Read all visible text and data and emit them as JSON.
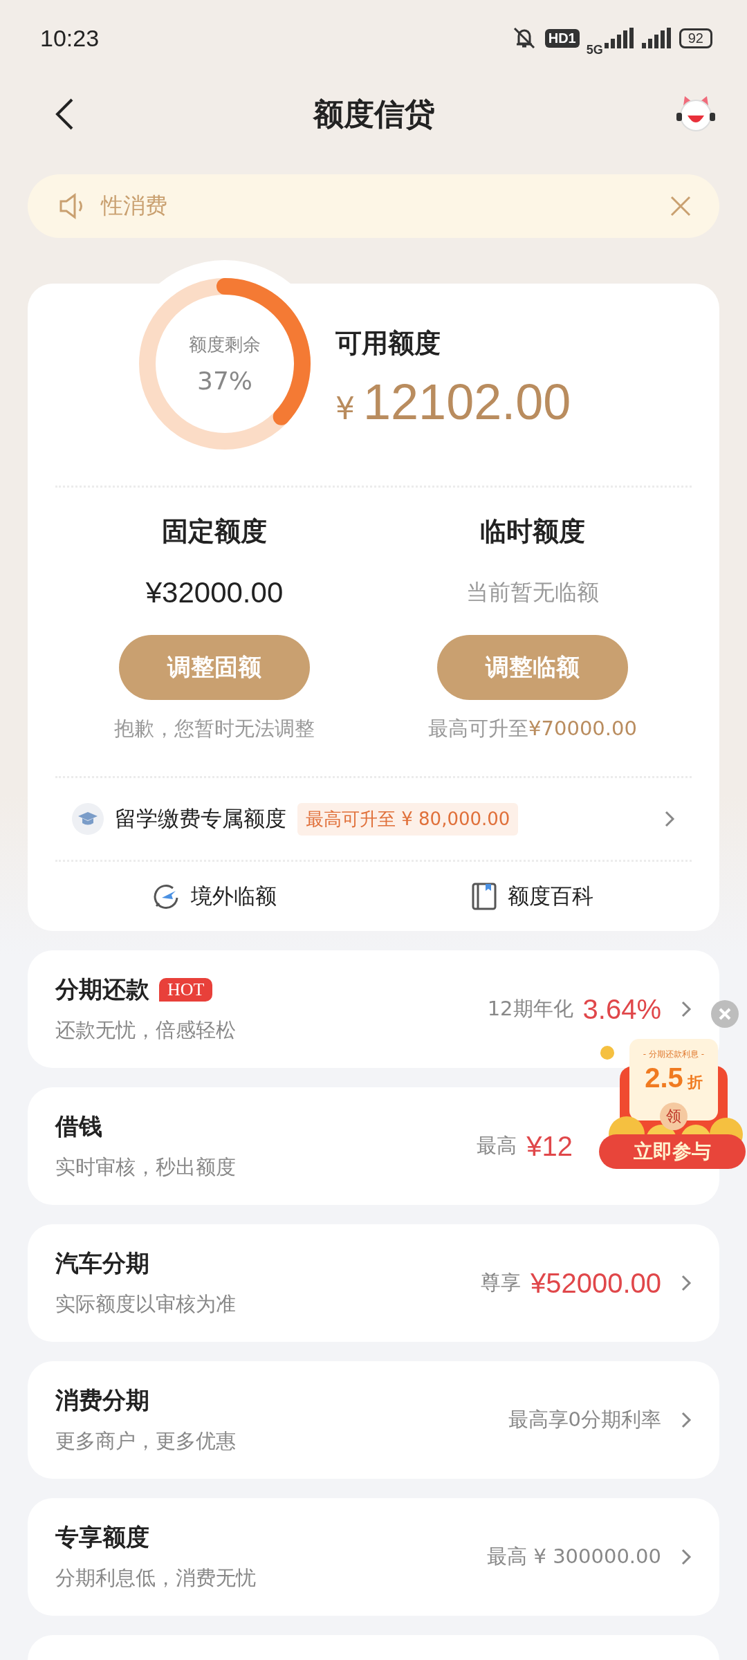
{
  "status_bar": {
    "time": "10:23",
    "hd_badge": "HD1",
    "network": "5G",
    "battery": "92"
  },
  "header": {
    "title": "额度信贷"
  },
  "notice": {
    "text": "性消费"
  },
  "credit": {
    "ring_label": "额度剩余",
    "ring_percent": "37%",
    "available_label": "可用额度",
    "currency": "¥",
    "available_amount": "12102.00",
    "columns": [
      {
        "title": "固定额度",
        "value": "¥32000.00",
        "kind": "amount",
        "button": "调整固额",
        "note": "抱歉，您暂时无法调整"
      },
      {
        "title": "临时额度",
        "value": "当前暂无临额",
        "kind": "hint",
        "button": "调整临额",
        "note": "最高可升至",
        "note_amount": "¥70000.00"
      }
    ]
  },
  "study": {
    "label": "留学缴费专属额度",
    "tag": "最高可升至 ¥ 80,000.00"
  },
  "links": [
    {
      "label": "境外临额",
      "kind": "plane"
    },
    {
      "label": "额度百科",
      "kind": "book"
    }
  ],
  "products": [
    {
      "title": "分期还款",
      "badge": "HOT",
      "subtitle": "还款无忧，倍感轻松",
      "prefix": "12期年化",
      "value": "3.64%",
      "chevron": true
    },
    {
      "title": "借钱",
      "subtitle": "实时审核，秒出额度",
      "prefix": "最高",
      "value": "¥12",
      "chevron": false
    },
    {
      "title": "汽车分期",
      "subtitle": "实际额度以审核为准",
      "prefix": "尊享",
      "value": "¥52000.00",
      "chevron": true
    },
    {
      "title": "消费分期",
      "subtitle": "更多商户，更多优惠",
      "prefix": "最高享0分期利率",
      "chevron": true
    },
    {
      "title": "专享额度",
      "subtitle": "分期利息低，消费无忧",
      "prefix": "最高 ¥ 300000.00",
      "chevron": true
    }
  ],
  "promo": {
    "caption": "- 分期还款利息 -",
    "number": "2.5",
    "unit": "折",
    "coin": "领",
    "button": "立即参与"
  }
}
